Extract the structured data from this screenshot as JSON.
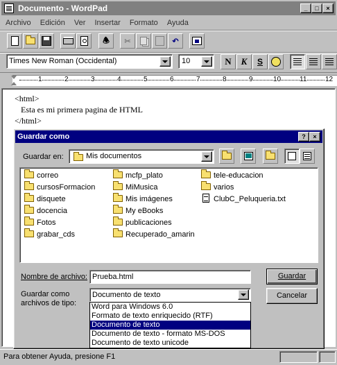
{
  "window": {
    "title": "Documento - WordPad"
  },
  "menu": [
    "Archivo",
    "Edición",
    "Ver",
    "Insertar",
    "Formato",
    "Ayuda"
  ],
  "toolbar": {
    "icons": [
      "new-document-icon",
      "open-folder-icon",
      "save-icon",
      "print-icon",
      "print-preview-icon",
      "find-icon",
      "cut-icon",
      "copy-icon",
      "paste-icon",
      "undo-icon",
      "insert-object-icon"
    ]
  },
  "format_bar": {
    "font": "Times New Roman (Occidental)",
    "size": "10",
    "bold": "N",
    "italic": "K",
    "underline": "S"
  },
  "ruler": {
    "numbers": [
      "1",
      "2",
      "3",
      "4",
      "5",
      "6",
      "7",
      "8",
      "9",
      "10",
      "11",
      "12"
    ]
  },
  "document": {
    "lines": [
      "<html>",
      "Esta es mi primera pagina de HTML",
      "</html>"
    ]
  },
  "dialog": {
    "title": "Guardar como",
    "help": "?",
    "close": "×",
    "look_in_label": "Guardar en:",
    "look_in_value": "Mis documentos",
    "files": [
      {
        "name": "correo",
        "type": "folder"
      },
      {
        "name": "cursosFormacion",
        "type": "folder"
      },
      {
        "name": "disquete",
        "type": "folder"
      },
      {
        "name": "docencia",
        "type": "folder"
      },
      {
        "name": "Fotos",
        "type": "folder"
      },
      {
        "name": "grabar_cds",
        "type": "folder"
      },
      {
        "name": "mcfp_plato",
        "type": "folder"
      },
      {
        "name": "MiMusica",
        "type": "folder"
      },
      {
        "name": "Mis imágenes",
        "type": "folder"
      },
      {
        "name": "My eBooks",
        "type": "folder"
      },
      {
        "name": "publicaciones",
        "type": "folder"
      },
      {
        "name": "Recuperado_amarin",
        "type": "folder"
      },
      {
        "name": "tele-educacion",
        "type": "folder"
      },
      {
        "name": "varios",
        "type": "folder"
      },
      {
        "name": "ClubC_Peluqueria.txt",
        "type": "file"
      }
    ],
    "filename_label": "Nombre de archivo:",
    "filename_value": "Prueba.html",
    "filetype_label_1": "Guardar como",
    "filetype_label_2": "archivos de tipo:",
    "filetype_value": "Documento de texto",
    "filetype_options": [
      "Word para Windows 6.0",
      "Formato de texto enriquecido (RTF)",
      "Documento de texto",
      "Documento de texto - formato MS-DOS",
      "Documento de texto unicode"
    ],
    "selected_option": "Documento de texto",
    "save_button": "Guardar",
    "cancel_button": "Cancelar"
  },
  "status": {
    "text": "Para obtener Ayuda, presione F1"
  }
}
